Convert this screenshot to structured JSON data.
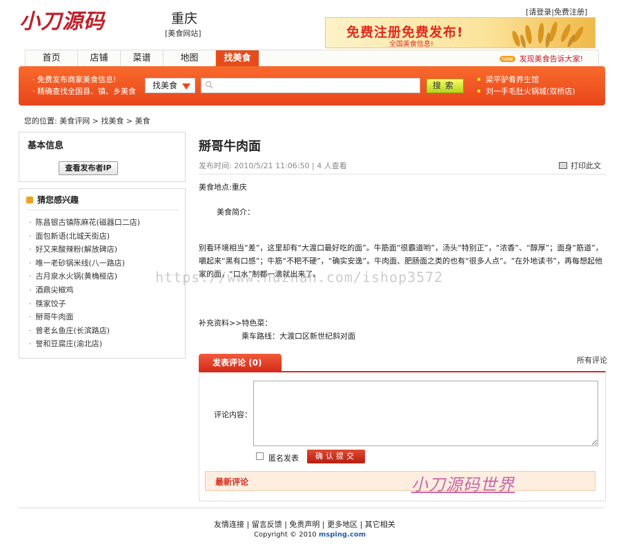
{
  "header": {
    "logo": "小刀源码",
    "city": "重庆",
    "site_sub": "[美食网站]",
    "top_links": "[请登录|免费注册]",
    "banner_main": "免费注册免费发布!",
    "banner_sub": "全国美食信息!"
  },
  "nav": {
    "items": [
      "首页",
      "店铺",
      "菜谱",
      "地图",
      "找美食"
    ],
    "right_text": "发现美食告诉大家!",
    "badge": "new"
  },
  "search": {
    "left_line1": "· 免费发布商家美食信息!",
    "left_line2": "· 精确查找全国县、镇、乡美食",
    "select_value": "找美食",
    "input_value": "",
    "button": "搜索",
    "right_line1": "梁平驴肴养生馆",
    "right_line2": "刘一手毛肚火锅城(双桥店)"
  },
  "breadcrumb": "您的位置: 美食评网 > 找美食 > 美食",
  "sidebar": {
    "basic_title": "基本信息",
    "ip_button": "查看发布者IP",
    "interest_title": "猜您感兴趣",
    "interest_items": [
      "陈昌银古镇陈麻花(磁器口二店)",
      "面包新语(北城天街店)",
      "好又来酸辣粉(解放碑店)",
      "唯一老砂锅米线(八一路店)",
      "古月泉水火锅(黄桷桠店)",
      "酒鼎尖椒鸡",
      "筷家饺子",
      "掰哥牛肉面",
      "曾老幺鱼庄(长滨路店)",
      "誉和豆腐庄(渝北店)"
    ]
  },
  "article": {
    "title": "掰哥牛肉面",
    "meta": "发布时间: 2010/5/21 11:06:50 | 4 人查看",
    "print": "打印此文",
    "location": "美食地点:重庆",
    "intro_label": "美食简介：",
    "body": "别看环境相当“差”，这里却有“大渡口最好吃的面”。牛筋面“很霸道哟”，汤头“特别正”，“浓香”、“醇厚”；面身“筋道”，嚼起来“黑有口感”；牛筋“不粑不硬”，“确实安逸”。牛肉面、肥肠面之类的也有“很多人点”。“在外地读书”，再每想起他家的面，“口水”制都一滴就出来了。",
    "extra1": "补充资料>>特色菜：",
    "extra2": "乘车路线：大渡口区新世纪斜对面",
    "watermark": "https://www.huzhan.com/ishop3572"
  },
  "comments": {
    "tab": "发表评论 (0)",
    "all": "所有评论",
    "content_label": "评论内容：",
    "anon_label": "匿名发表",
    "submit": "确认提交",
    "latest": "最新评论",
    "signature": "小刀源码世界"
  },
  "footer": {
    "links": "友情连接 | 留言反馈 | 免责声明 | 更多地区 | 其它相关",
    "copyright_prefix": "Copyright © 2010",
    "copyright_site": "msping.com"
  },
  "colors": {
    "accent": "#e64c1b",
    "brand_red": "#c0202a",
    "search_button": "#b6d61c"
  }
}
